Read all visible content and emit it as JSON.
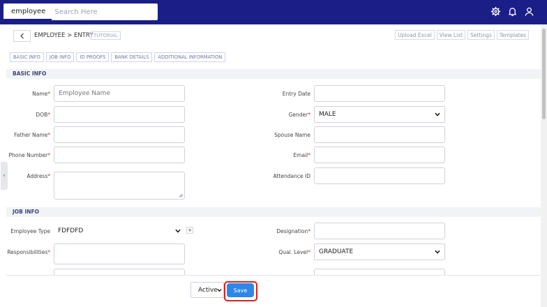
{
  "topbar": {
    "module": "employee",
    "search_placeholder": "Search Here"
  },
  "header": {
    "breadcrumb": "EMPLOYEE > ENTRY",
    "tutorial_label": "TUTORIAL",
    "actions": [
      "Upload Excel",
      "View List",
      "Settings",
      "Templates"
    ]
  },
  "section_tabs": [
    "BASIC INFO",
    "JOB INFO",
    "ID PROOFS",
    "BANK DETAILS",
    "ADDITIONAL INFORMATION"
  ],
  "basic_info": {
    "title": "BASIC INFO",
    "name_label": "Name",
    "name_placeholder": "Employee Name",
    "dob_label": "DOB",
    "father_label": "Father Name",
    "phone_label": "Phone Number",
    "address_label": "Address",
    "entry_date_label": "Entry Date",
    "gender_label": "Gender",
    "gender_value": "MALE",
    "spouse_label": "Spouse Name",
    "email_label": "Email",
    "attendance_label": "Attendance ID"
  },
  "job_info": {
    "title": "JOB INFO",
    "employee_type_label": "Employee Type",
    "employee_type_value": "FDFDFD",
    "plus_label": "+",
    "responsibilities_label": "Responsibilities",
    "designation_label": "Designation",
    "qual_level_label": "Qual. Level",
    "qual_level_value": "GRADUATE"
  },
  "footer": {
    "status_value": "Active",
    "save_label": "Save"
  },
  "colors": {
    "topbar": "#1a1e86",
    "save_button": "#2e86e6",
    "highlight": "#d9201f",
    "required": "#d9252b"
  }
}
